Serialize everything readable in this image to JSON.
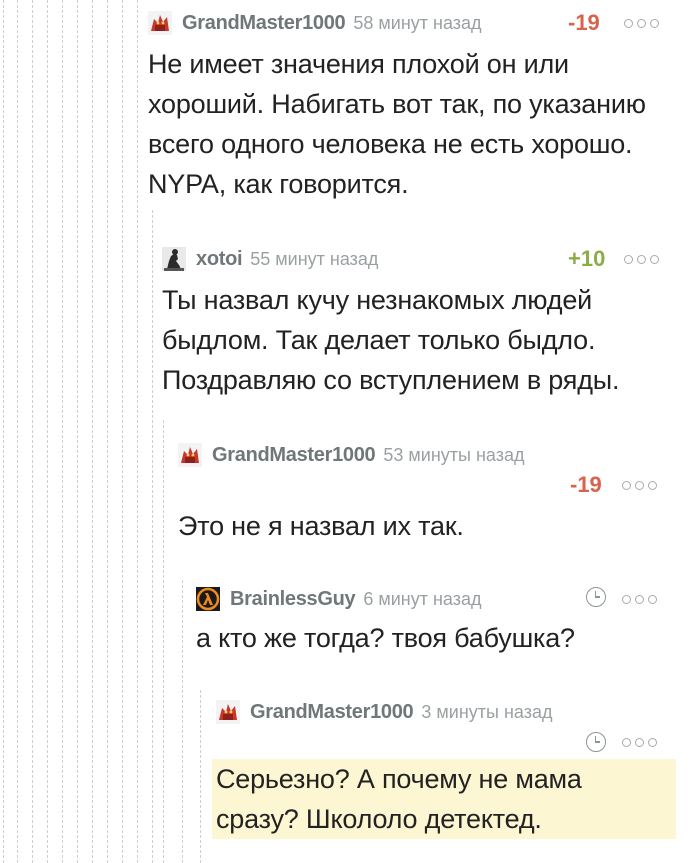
{
  "colors": {
    "negative": "#d8624b",
    "positive": "#8aae45",
    "highlight": "#fcf6d3"
  },
  "comments": [
    {
      "author": "GrandMaster1000",
      "time": "58 минут назад",
      "rating": "-19",
      "avatar_icon": "red-creature-avatar",
      "lines": [
        "Не имеет значения плохой он или",
        "хороший. Набигать вот так, по указанию",
        "всего одного человека не есть хорошо.",
        "NYPA, как говорится."
      ]
    },
    {
      "author": "xotoi",
      "time": "55 минут назад",
      "rating": "+10",
      "avatar_icon": "thinker-statue-avatar",
      "lines": [
        "Ты назвал кучу незнакомых людей",
        "быдлом. Так делает только быдло.",
        "Поздравляю со вступлением в ряды."
      ]
    },
    {
      "author": "GrandMaster1000",
      "time": "53 минуты назад",
      "rating": "-19",
      "avatar_icon": "red-creature-avatar",
      "lines": [
        "Это не я назвал их так."
      ]
    },
    {
      "author": "BrainlessGuy",
      "time": "6 минут назад",
      "rating": "",
      "avatar_icon": "half-life-lambda-avatar",
      "lines": [
        "а кто же тогда? твоя бабушка?"
      ]
    },
    {
      "author": "GrandMaster1000",
      "time": "3 минуты назад",
      "rating": "",
      "avatar_icon": "red-creature-avatar",
      "lines": [
        "Серьезно? А почему не мама",
        "сразу? Школоло детектед."
      ]
    }
  ]
}
